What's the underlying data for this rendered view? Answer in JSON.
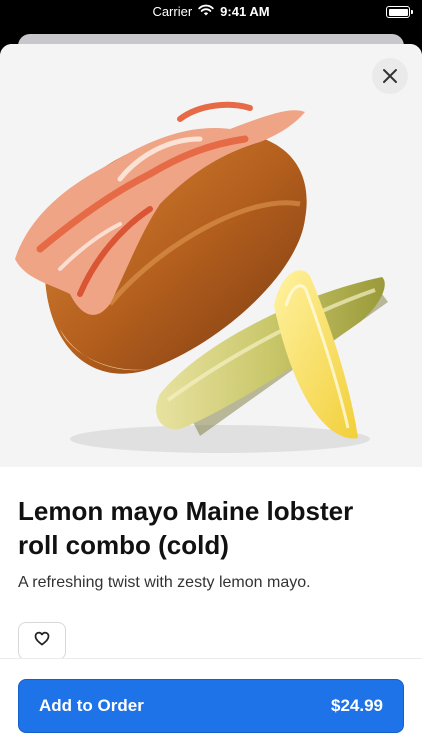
{
  "status_bar": {
    "carrier": "Carrier",
    "time": "9:41 AM",
    "icons": [
      "wifi-icon",
      "battery-icon"
    ]
  },
  "product": {
    "image_icon": "lobster-roll-image",
    "title": "Lemon mayo Maine lobster roll combo (cold)",
    "description": "A refreshing twist with zesty lemon mayo."
  },
  "actions": {
    "close_icon": "close-icon",
    "favorite_icon": "heart-icon",
    "add_to_order_label": "Add to Order",
    "price": "$24.99"
  },
  "colors": {
    "accent": "#1e73e8",
    "text": "#111111",
    "sheet_background": "#ffffff",
    "status_background": "#000000"
  }
}
